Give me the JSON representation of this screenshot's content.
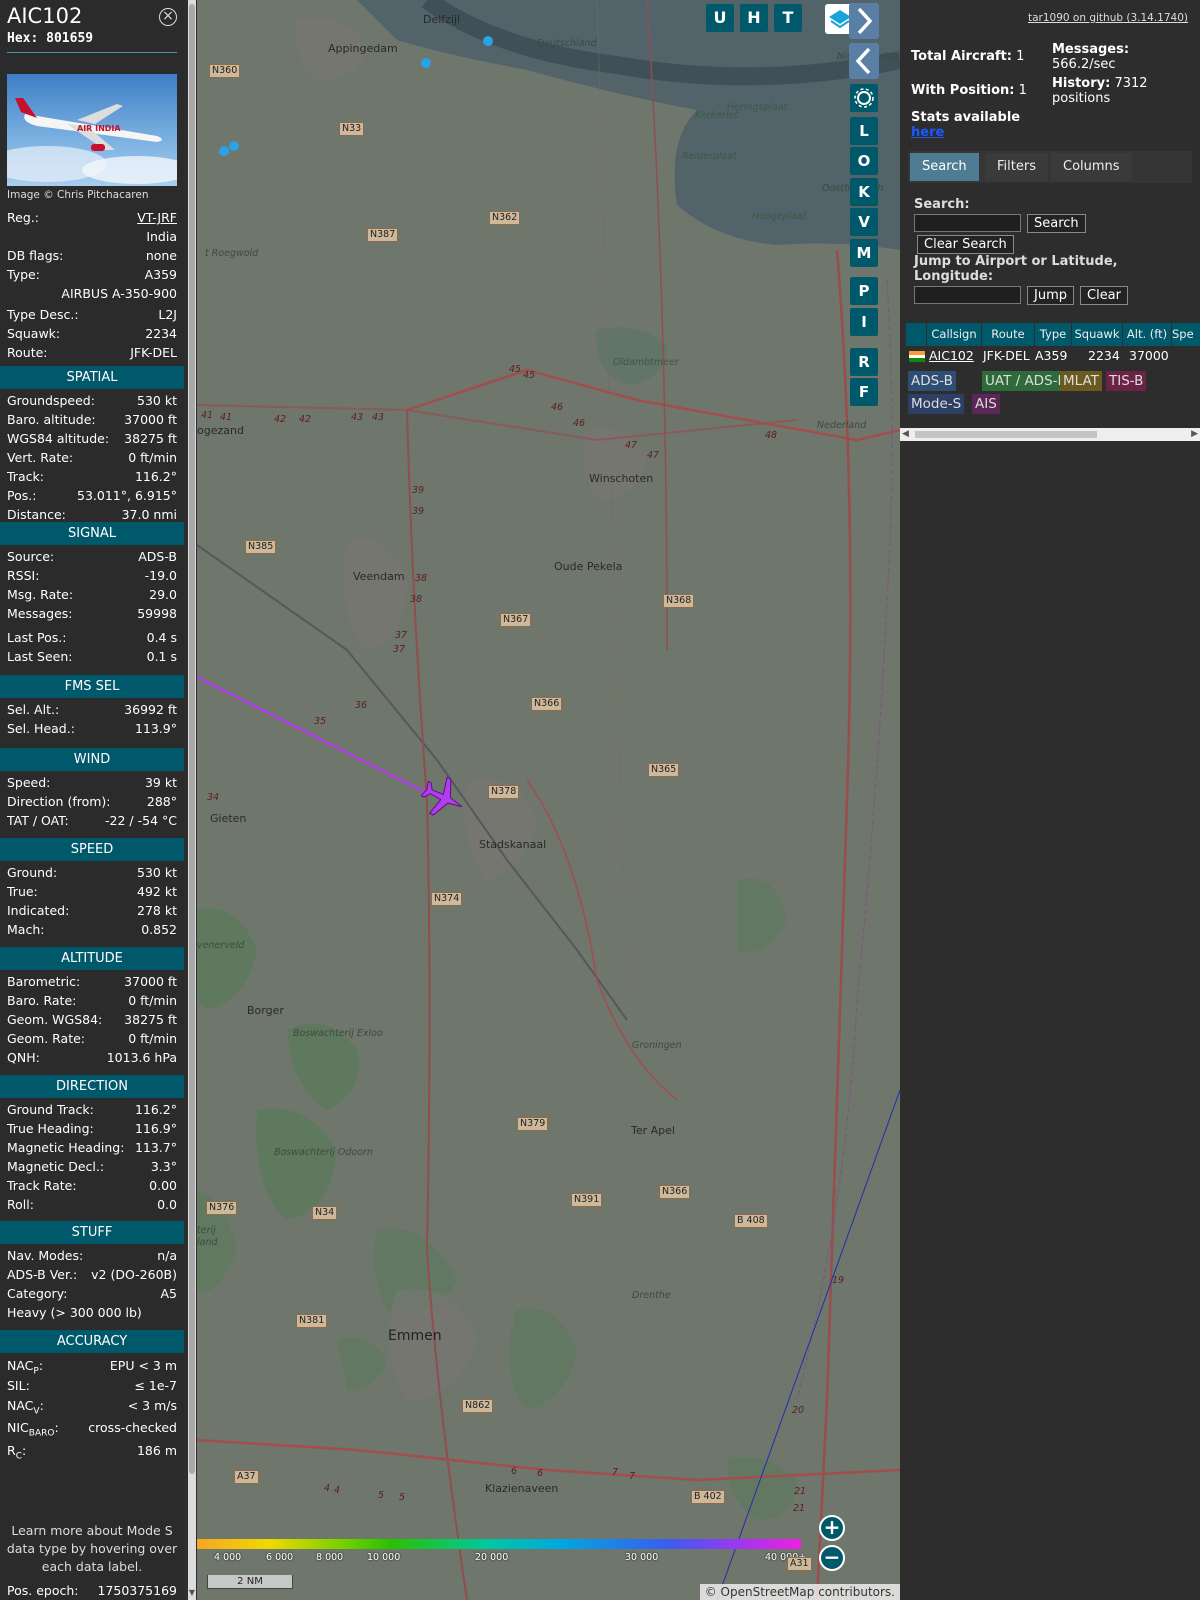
{
  "info": {
    "callsign": "AIC102",
    "hex_label": "Hex:",
    "hex": "801659",
    "photo_credit": "Image © Chris Pitchacaren",
    "photo_livery_text": "AIR INDIA",
    "rows_top": [
      {
        "label": "Reg.:",
        "value": "VT-JRF"
      },
      {
        "label": "",
        "value": "India"
      },
      {
        "label": "DB flags:",
        "value": "none"
      },
      {
        "label": "Type:",
        "value": "A359"
      },
      {
        "label": "",
        "value": "AIRBUS A-350-900"
      },
      {
        "label": "Type Desc.:",
        "value": "L2J"
      },
      {
        "label": "Squawk:",
        "value": "2234"
      },
      {
        "label": "Route:",
        "value": "JFK-DEL"
      }
    ],
    "spatial": {
      "title": "SPATIAL",
      "rows": [
        {
          "label": "Groundspeed:",
          "value": "530 kt"
        },
        {
          "label": "Baro. altitude:",
          "value": "37000 ft"
        },
        {
          "label": "WGS84 altitude:",
          "value": "38275 ft"
        },
        {
          "label": "Vert. Rate:",
          "value": "0 ft/min"
        },
        {
          "label": "Track:",
          "value": "116.2°"
        },
        {
          "label": "Pos.:",
          "value": "53.011°, 6.915°"
        },
        {
          "label": "Distance:",
          "value": "37.0 nmi"
        }
      ]
    },
    "signal": {
      "title": "SIGNAL",
      "rows": [
        {
          "label": "Source:",
          "value": "ADS-B"
        },
        {
          "label": "RSSI:",
          "value": "-19.0"
        },
        {
          "label": "Msg. Rate:",
          "value": "29.0"
        },
        {
          "label": "Messages:",
          "value": "59998"
        },
        {
          "label": "Last Pos.:",
          "value": "0.4 s"
        },
        {
          "label": "Last Seen:",
          "value": "0.1 s"
        }
      ]
    },
    "fms": {
      "title": "FMS SEL",
      "rows": [
        {
          "label": "Sel. Alt.:",
          "value": "36992 ft"
        },
        {
          "label": "Sel. Head.:",
          "value": "113.9°"
        }
      ]
    },
    "wind": {
      "title": "WIND",
      "rows": [
        {
          "label": "Speed:",
          "value": "39 kt"
        },
        {
          "label": "Direction (from):",
          "value": "288°"
        },
        {
          "label": "TAT / OAT:",
          "value": "-22 / -54 °C"
        }
      ]
    },
    "speed": {
      "title": "SPEED",
      "rows": [
        {
          "label": "Ground:",
          "value": "530 kt"
        },
        {
          "label": "True:",
          "value": "492 kt"
        },
        {
          "label": "Indicated:",
          "value": "278 kt"
        },
        {
          "label": "Mach:",
          "value": "0.852"
        }
      ]
    },
    "altitude": {
      "title": "ALTITUDE",
      "rows": [
        {
          "label": "Barometric:",
          "value": "37000 ft"
        },
        {
          "label": "Baro. Rate:",
          "value": "0 ft/min"
        },
        {
          "label": "Geom. WGS84:",
          "value": "38275 ft"
        },
        {
          "label": "Geom. Rate:",
          "value": "0 ft/min"
        },
        {
          "label": "QNH:",
          "value": "1013.6 hPa"
        }
      ]
    },
    "direction": {
      "title": "DIRECTION",
      "rows": [
        {
          "label": "Ground Track:",
          "value": "116.2°"
        },
        {
          "label": "True Heading:",
          "value": "116.9°"
        },
        {
          "label": "Magnetic Heading:",
          "value": "113.7°"
        },
        {
          "label": "Magnetic Decl.:",
          "value": "3.3°"
        },
        {
          "label": "Track Rate:",
          "value": "0.00"
        },
        {
          "label": "Roll:",
          "value": "0.0"
        }
      ]
    },
    "stuff": {
      "title": "STUFF",
      "rows": [
        {
          "label": "Nav. Modes:",
          "value": "n/a"
        },
        {
          "label": "ADS-B Ver.:",
          "value": "v2 (DO-260B)"
        },
        {
          "label": "Category:",
          "value": "A5"
        },
        {
          "label": "Heavy (> 300 000 lb)",
          "value": ""
        }
      ]
    },
    "accuracy": {
      "title": "ACCURACY",
      "rows": [
        {
          "label": "NAC",
          "sub": "P",
          "value": "EPU < 3 m"
        },
        {
          "label": "SIL:",
          "sub": "",
          "value": "≤ 1e-7"
        },
        {
          "label": "NAC",
          "sub": "V",
          "value": "< 3 m/s"
        },
        {
          "label": "NIC",
          "sub": "BARO",
          "value": "cross-checked"
        },
        {
          "label": "R",
          "sub": "C",
          "value": "186 m"
        }
      ]
    },
    "learn_more": "Learn more about Mode S data type by hovering over each data label.",
    "pos_epoch_label": "Pos. epoch:",
    "pos_epoch": "1750375169"
  },
  "map": {
    "top_buttons": [
      "U",
      "H",
      "T"
    ],
    "side_buttons": [
      "L",
      "O",
      "K",
      "V",
      "M",
      "P",
      "I",
      "R",
      "F"
    ],
    "zoom_in": "+",
    "zoom_out": "−",
    "attribution_prefix": "©",
    "attribution_link": "OpenStreetMap",
    "attribution_suffix": "contributors.",
    "scale_label": "2 NM",
    "altitude_scale_labels": [
      "4 000",
      "6 000",
      "8 000",
      "10 000",
      "20 000",
      "30 000",
      "40 000+"
    ],
    "places": [
      "Delfzijl",
      "Appingedam",
      "Veendam",
      "Winschoten",
      "Oude Pekela",
      "Stadskanaal",
      "Gieten",
      "Borger",
      "Ter Apel",
      "Emmen",
      "Klazienaveen",
      "ogezand",
      "t Roegwold",
      "venerveld",
      "Oldambtmeer",
      "Kerkeriet",
      "Reiderplaat",
      "Heringsplaat",
      "Hoogeplaat",
      "Niedersachsen",
      "Deutschland",
      "Nederland",
      "Groningen",
      "Drenthe",
      "Boswachterij Exloo",
      "Boswachterij Odoorn",
      "Oostfriesisch",
      "terij",
      "land"
    ],
    "road_labels": [
      "N360",
      "N33",
      "N362",
      "N387",
      "N385",
      "N367",
      "N368",
      "N366",
      "N365",
      "N378",
      "N374",
      "N379",
      "N391",
      "N366",
      "B 408",
      "N376",
      "N34",
      "N381",
      "N862",
      "A37",
      "B 402",
      "A31"
    ],
    "route_numbers": [
      "45",
      "45",
      "46",
      "46",
      "47",
      "47",
      "48",
      "41",
      "41",
      "42",
      "42",
      "43",
      "43",
      "39",
      "39",
      "38",
      "38",
      "37",
      "37",
      "36",
      "35",
      "34",
      "19",
      "20",
      "21",
      "21",
      "6",
      "6",
      "5",
      "5",
      "4",
      "4",
      "7",
      "7"
    ],
    "colors": {
      "trail": "#c030ff",
      "aircraft": "#b33cf0",
      "panel_accent": "#00596b"
    }
  },
  "right": {
    "github_link": "tar1090 on github (3.14.1740)",
    "total_aircraft_label": "Total Aircraft:",
    "total_aircraft": "1",
    "with_position_label": "With Position:",
    "with_position": "1",
    "stats_label": "Stats available",
    "stats_link": "here",
    "messages_label": "Messages:",
    "messages_rate": "566.2/sec",
    "history_label": "History:",
    "history_value": "7312",
    "history_unit": "positions",
    "tabs": [
      "Search",
      "Filters",
      "Columns"
    ],
    "search_label": "Search:",
    "search_button": "Search",
    "clear_search_button": "Clear Search",
    "jump_label": "Jump to Airport or Latitude, Longitude:",
    "jump_button": "Jump",
    "clear_button": "Clear",
    "table": {
      "columns": [
        "Callsign",
        "Route",
        "Type",
        "Squawk",
        "Alt. (ft)",
        "Spe"
      ],
      "rows": [
        {
          "callsign": "AIC102",
          "route": "JFK-DEL",
          "type": "A359",
          "squawk": "2234",
          "alt": "37000"
        }
      ]
    },
    "badges": [
      {
        "label": "ADS-B",
        "color": "#2f4e74"
      },
      {
        "label": "UAT / ADS-R",
        "color": "#2f6a3a"
      },
      {
        "label": "MLAT",
        "color": "#6b5a1f"
      },
      {
        "label": "TIS-B",
        "color": "#6a2448"
      },
      {
        "label": "Mode-S",
        "color": "#2e3f66"
      },
      {
        "label": "AIS",
        "color": "#5a2757"
      }
    ]
  }
}
